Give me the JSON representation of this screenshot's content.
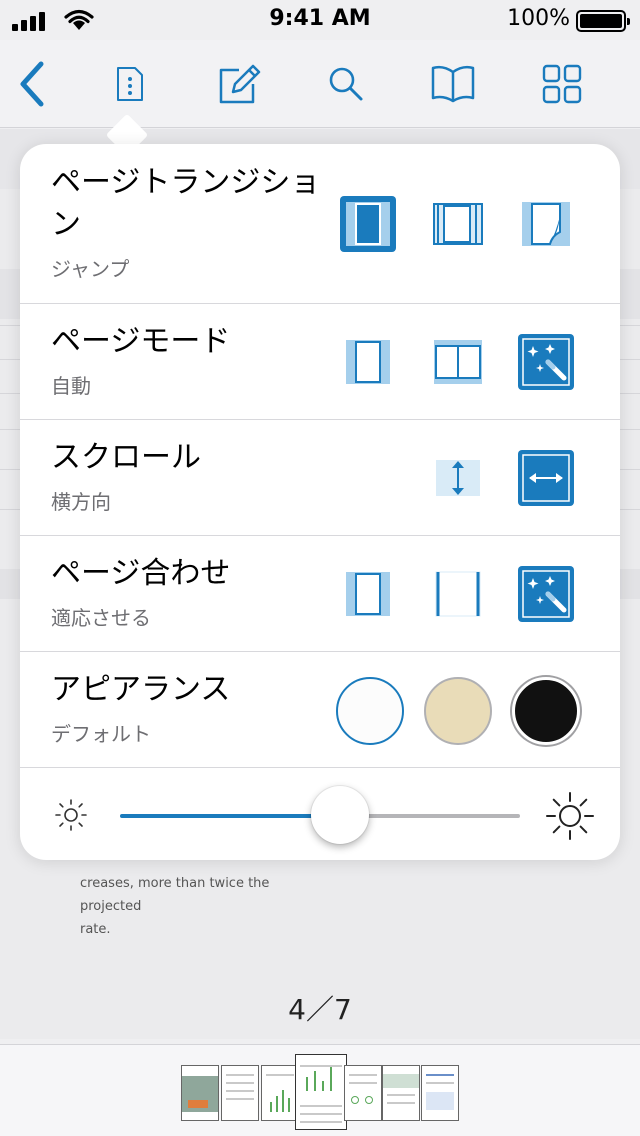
{
  "status_bar": {
    "time": "9:41 AM",
    "battery": "100%"
  },
  "toolbar": {
    "items": [
      "back-icon",
      "document-menu-icon",
      "edit-icon",
      "search-icon",
      "book-icon",
      "grid-icon"
    ],
    "accent": "#1a7bbd"
  },
  "document": {
    "text_lines": [
      "creases, more than twice the projected",
      "rate."
    ]
  },
  "popover": {
    "rows": [
      {
        "title": "ページトランジション",
        "subtitle": "ジャンプ"
      },
      {
        "title": "ページモード",
        "subtitle": "自動"
      },
      {
        "title": "スクロール",
        "subtitle": "横方向"
      },
      {
        "title": "ページ合わせ",
        "subtitle": "適応させる"
      },
      {
        "title": "アピアランス",
        "subtitle": "デフォルト"
      }
    ],
    "appearance_colors": [
      "#ffffff",
      "#e9dcb8",
      "#111111"
    ],
    "brightness": 0.55
  },
  "page_indicator": "4／7",
  "thumbnails": {
    "count": 7,
    "current_index": 3
  }
}
